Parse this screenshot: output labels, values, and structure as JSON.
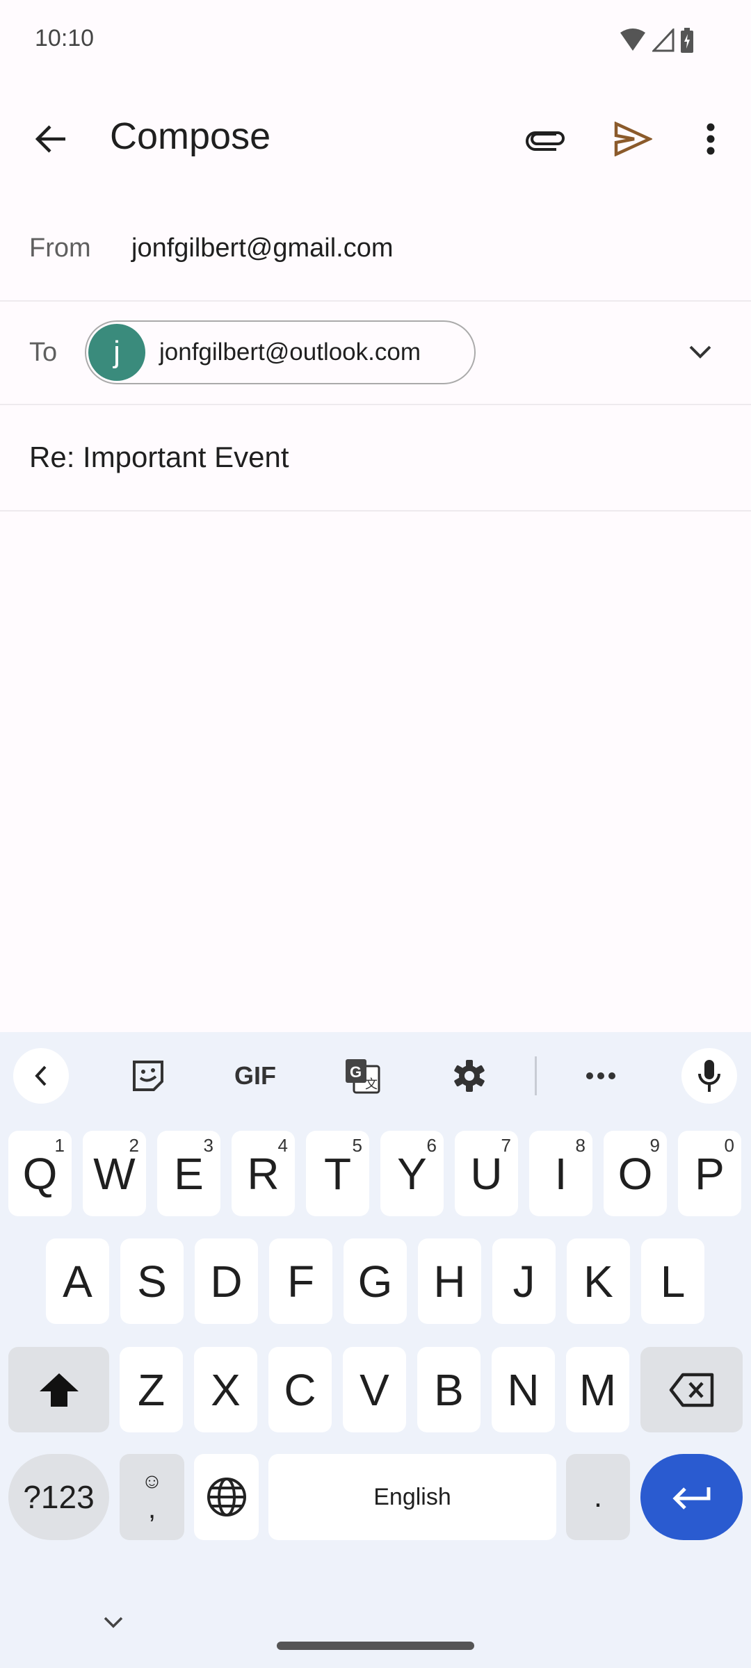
{
  "status_bar": {
    "time": "10:10",
    "icons": [
      "wifi-icon",
      "signal-icon",
      "battery-charging-icon"
    ]
  },
  "toolbar": {
    "title": "Compose",
    "icons": [
      "back-arrow-icon",
      "attach-icon",
      "send-icon",
      "more-vert-icon"
    ],
    "send_color": "#8b5a2b"
  },
  "from": {
    "label": "From",
    "value": "jonfgilbert@gmail.com"
  },
  "to": {
    "label": "To",
    "chip_initial": "j",
    "chip_email": "jonfgilbert@outlook.com",
    "avatar_color": "#3a8b7c"
  },
  "subject": {
    "value": "Re: Important Event"
  },
  "keyboard": {
    "toolbar_icons": [
      "chevron-left-icon",
      "sticker-icon",
      "gif-icon",
      "translate-icon",
      "gear-icon",
      "more-horiz-icon",
      "mic-icon"
    ],
    "gif_label": "GIF",
    "row1": [
      {
        "k": "Q",
        "n": "1"
      },
      {
        "k": "W",
        "n": "2"
      },
      {
        "k": "E",
        "n": "3"
      },
      {
        "k": "R",
        "n": "4"
      },
      {
        "k": "T",
        "n": "5"
      },
      {
        "k": "Y",
        "n": "6"
      },
      {
        "k": "U",
        "n": "7"
      },
      {
        "k": "I",
        "n": "8"
      },
      {
        "k": "O",
        "n": "9"
      },
      {
        "k": "P",
        "n": "0"
      }
    ],
    "row2": [
      "A",
      "S",
      "D",
      "F",
      "G",
      "H",
      "J",
      "K",
      "L"
    ],
    "row3": [
      "Z",
      "X",
      "C",
      "V",
      "B",
      "N",
      "M"
    ],
    "symbols_label": "?123",
    "comma_label": ",",
    "space_label": "English",
    "period_label": ".",
    "enter_color": "#2a5bd0"
  }
}
